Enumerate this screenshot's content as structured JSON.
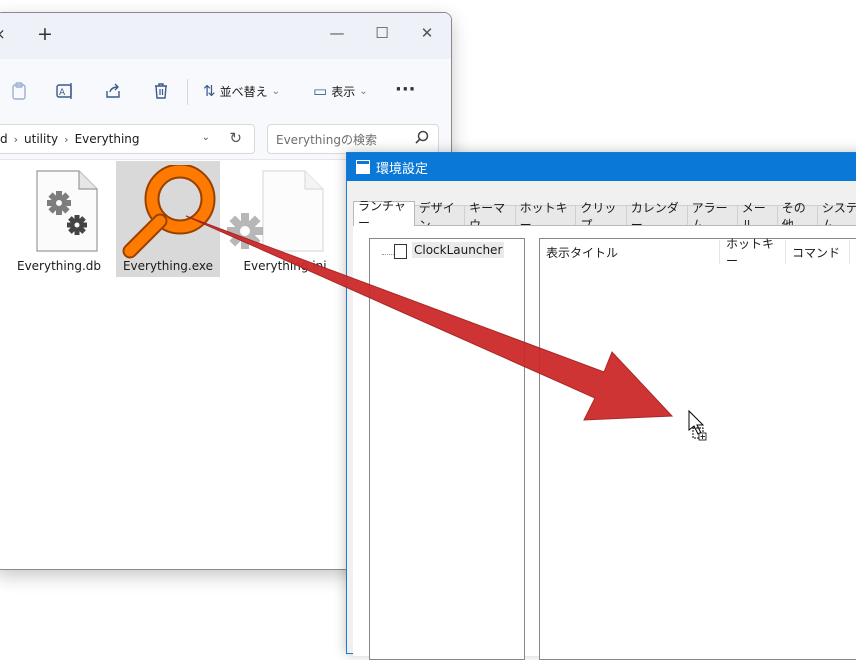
{
  "explorer": {
    "new_tab": "+",
    "tab_close": "×",
    "window_controls": {
      "minimize": "—",
      "maximize": "☐",
      "close": "✕"
    },
    "toolbar": {
      "sort_label": "並べ替え",
      "view_label": "表示",
      "more": "···",
      "icons": [
        "paste-icon",
        "rename-icon",
        "share-icon",
        "delete-icon"
      ]
    },
    "breadcrumb": [
      "d",
      "utility",
      "Everything"
    ],
    "search": {
      "placeholder": "Everythingの検索"
    },
    "files": [
      {
        "name": "Everything.db",
        "icon": "settings-file-icon",
        "selected": false
      },
      {
        "name": "Everything.exe",
        "icon": "everything-magnifier-icon",
        "selected": true
      },
      {
        "name": "Everything.ini",
        "icon": "settings-file-icon",
        "selected": false
      }
    ],
    "drag_label": "Everything.ini"
  },
  "dialog": {
    "title": "環境設定",
    "tabs": [
      "ランチャー",
      "デザイン",
      "キーマウ",
      "ホットキー",
      "クリップ",
      "カレンダー",
      "アラーム",
      "メール",
      "その他",
      "システム"
    ],
    "active_tab": "ランチャー",
    "tree": {
      "root": "ClockLauncher"
    },
    "columns": [
      "表示タイトル",
      "ホットキー",
      "コマンド"
    ]
  },
  "colors": {
    "accent": "#0a78d7",
    "arrow": "#cc2a2a",
    "everything_orange": "#ff7a00"
  }
}
